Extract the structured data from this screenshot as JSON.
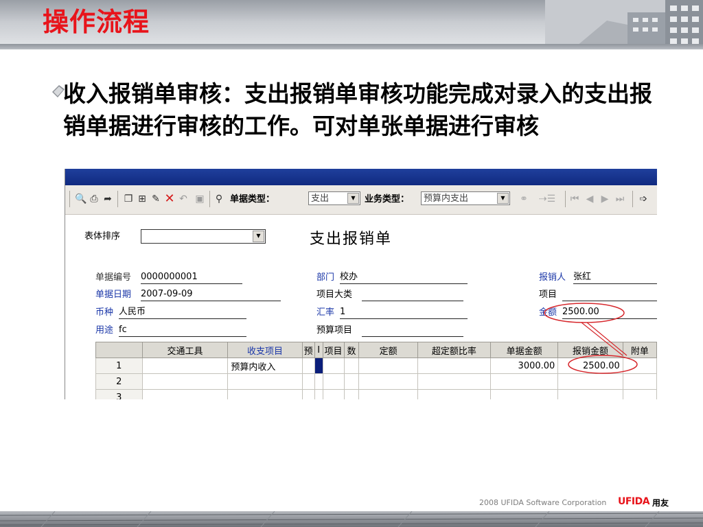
{
  "slide": {
    "title": "操作流程",
    "body": "收入报销单审核：支出报销单审核功能完成对录入的支出报销单据进行审核的工作。可对单张单据进行审核",
    "footer_text": "2008 UFIDA Software Corporation",
    "brand": "UFIDA",
    "brand_cn": "用友"
  },
  "toolbar": {
    "doc_type_label": "单据类型：",
    "doc_type_value": "支出",
    "biz_type_label": "业务类型：",
    "biz_type_value": "预算内支出"
  },
  "form": {
    "title": "支出报销单",
    "sort_label": "表体排序",
    "sort_value": "",
    "fields": {
      "doc_no_label": "单据编号",
      "doc_no": "0000000001",
      "dept_label": "部门",
      "dept": "校办",
      "reporter_label": "报销人",
      "reporter": "张红",
      "date_label": "单据日期",
      "date": "2007-09-09",
      "project_cat_label": "项目大类",
      "project_cat": "",
      "project_label": "项目",
      "project": "",
      "currency_label": "币种",
      "currency": "人民币",
      "rate_label": "汇率",
      "rate": "1",
      "amount_label": "金额",
      "amount": "2500.00",
      "purpose_label": "用途",
      "purpose": "fc",
      "budget_item_label": "预算项目",
      "budget_item": ""
    }
  },
  "grid": {
    "headers": [
      "",
      "交通工具",
      "收支项目",
      "预",
      "I",
      "项目",
      "数",
      "定额",
      "超定额比率",
      "单据金额",
      "报销金额",
      "附单"
    ],
    "rows": [
      [
        "1",
        "",
        "预算内收入",
        "",
        "",
        "",
        "",
        "",
        "",
        "3000.00",
        "2500.00",
        ""
      ],
      [
        "2",
        "",
        "",
        "",
        "",
        "",
        "",
        "",
        "",
        "",
        "",
        ""
      ],
      [
        "3",
        "",
        "",
        "",
        "",
        "",
        "",
        "",
        "",
        "",
        "",
        ""
      ]
    ]
  },
  "colors": {
    "title_red": "#e8141b",
    "required_label_blue": "#1b37a8",
    "annotation_red": "#d6262b"
  }
}
